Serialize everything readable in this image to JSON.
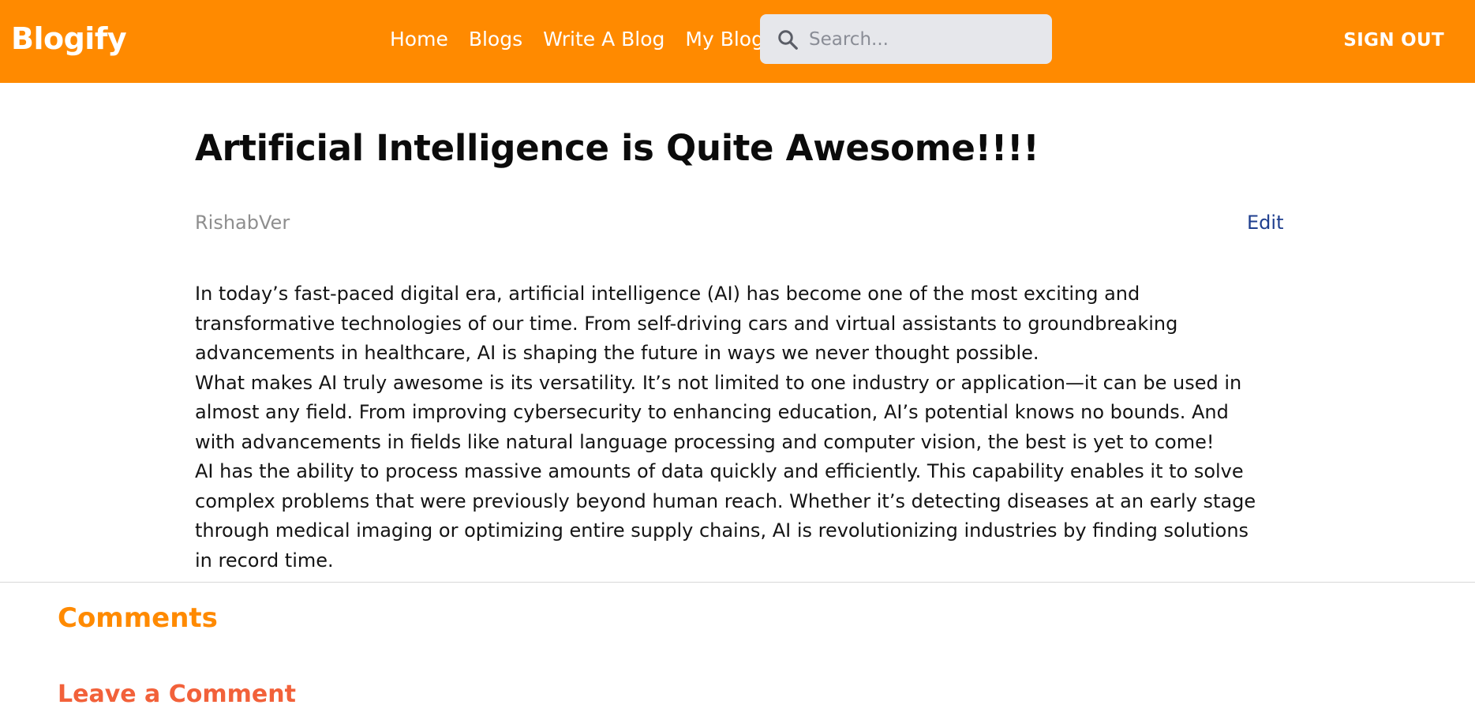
{
  "header": {
    "brand": "Blogify",
    "nav": [
      {
        "label": "Home"
      },
      {
        "label": "Blogs"
      },
      {
        "label": "Write A Blog"
      },
      {
        "label": "My Blogs"
      }
    ],
    "search": {
      "placeholder": "Search...",
      "value": ""
    },
    "signout_label": "SIGN OUT"
  },
  "post": {
    "title": "Artificial Intelligence is Quite Awesome!!!!",
    "author": "RishabVer",
    "edit_label": "Edit",
    "paragraphs": [
      "In today’s fast-paced digital era, artificial intelligence (AI) has become one of the most exciting and transformative technologies of our time. From self-driving cars and virtual assistants to groundbreaking advancements in healthcare, AI is shaping the future in ways we never thought possible.",
      "What makes AI truly awesome is its versatility. It’s not limited to one industry or application—it can be used in almost any field. From improving cybersecurity to enhancing education, AI’s potential knows no bounds. And with advancements in fields like natural language processing and computer vision, the best is yet to come!",
      "AI has the ability to process massive amounts of data quickly and efficiently. This capability enables it to solve complex problems that were previously beyond human reach. Whether it’s detecting diseases at an early stage through medical imaging or optimizing entire supply chains, AI is revolutionizing industries by finding solutions in record time."
    ]
  },
  "comments": {
    "title": "Comments",
    "leave_label": "Leave a Comment"
  },
  "colors": {
    "header_bg": "#ff8a00",
    "comments_title": "#ff8a00",
    "leave_comment": "#f2613a",
    "edit_link": "#1f3f8f",
    "author": "#8e8e8e"
  },
  "icons": {
    "search": "search-icon"
  }
}
